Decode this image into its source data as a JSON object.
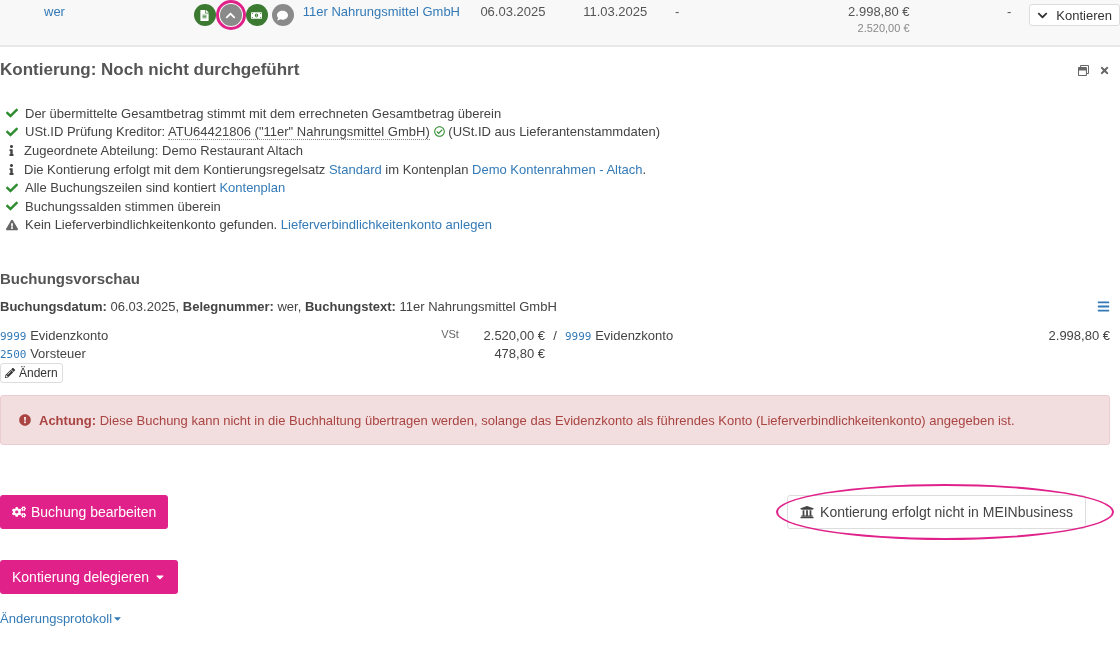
{
  "document_row": {
    "reference": "wer",
    "icons": [
      {
        "kind": "document",
        "color": "#3c7a32",
        "highlighted": false
      },
      {
        "kind": "collapse",
        "color": "#8a8a8a",
        "highlighted": true
      },
      {
        "kind": "money",
        "color": "#3c7a32",
        "highlighted": false
      },
      {
        "kind": "comment",
        "color": "#8a8a8a",
        "highlighted": false
      }
    ],
    "vendor": "11er Nahrungsmittel GmbH",
    "date_1": "06.03.2025",
    "date_2": "11.03.2025",
    "column_6": "-",
    "gross_amount": "2.998,80 €",
    "net_amount": "2.520,00 €",
    "column_8": "-",
    "action_button": "Kontieren"
  },
  "panel": {
    "title": "Kontierung: Noch nicht durchgeführt",
    "checks": [
      {
        "kind": "check",
        "parts": [
          {
            "kind": "text",
            "text": "Der übermittelte Gesamtbetrag stimmt mit dem errechneten Gesamtbetrag überein"
          }
        ]
      },
      {
        "kind": "check",
        "parts": [
          {
            "kind": "text",
            "text": "USt.ID Prüfung Kreditor: "
          },
          {
            "kind": "dotted",
            "text": "ATU64421806 (\"11er\" Nahrungsmittel GmbH)"
          },
          {
            "kind": "ok-icon"
          },
          {
            "kind": "text",
            "text": " (USt.ID aus Lieferantenstammdaten)"
          }
        ]
      },
      {
        "kind": "info",
        "parts": [
          {
            "kind": "text",
            "text": "Zugeordnete Abteilung: Demo Restaurant Altach"
          }
        ]
      },
      {
        "kind": "info",
        "parts": [
          {
            "kind": "text",
            "text": "Die Kontierung erfolgt mit dem Kontierungsregelsatz "
          },
          {
            "kind": "link",
            "text": "Standard"
          },
          {
            "kind": "text",
            "text": " im Kontenplan "
          },
          {
            "kind": "link",
            "text": "Demo Kontenrahmen - Altach"
          },
          {
            "kind": "text",
            "text": "."
          }
        ]
      },
      {
        "kind": "check",
        "parts": [
          {
            "kind": "text",
            "text": "Alle Buchungszeilen sind kontiert "
          },
          {
            "kind": "link",
            "text": "Kontenplan"
          }
        ]
      },
      {
        "kind": "check",
        "parts": [
          {
            "kind": "text",
            "text": "Buchungssalden stimmen überein"
          }
        ]
      },
      {
        "kind": "warning",
        "parts": [
          {
            "kind": "text",
            "text": "Kein Lieferverbindlichkeitenkonto gefunden. "
          },
          {
            "kind": "link",
            "text": "Lieferverbindlichkeitenkonto anlegen"
          }
        ]
      }
    ],
    "preview": {
      "title": "Buchungsvorschau",
      "header": "**Buchungsdatum:** 06.03.2025, **Belegnummer:** wer, **Buchungstext:** 11er Nahrungsmittel GmbH",
      "lines": [
        {
          "debit_account": "9999",
          "debit_name": "Evidenzkonto",
          "tax_code": "VSt",
          "debit_amount": "2.520,00 €",
          "separator": "/",
          "credit_account": "9999",
          "credit_name": "Evidenzkonto",
          "credit_amount": "2.998,80 €"
        },
        {
          "debit_account": "2500",
          "debit_name": "Vorsteuer",
          "debit_amount": "478,80 €"
        }
      ],
      "edit_button": "Ändern"
    },
    "alert": "**Achtung:** Diese Buchung kann nicht in die Buchhaltung übertragen werden, solange das Evidenzkonto als führendes Konto (Lieferverbindlichkeitenkonto) angegeben ist.",
    "edit_booking_button": "Buchung bearbeiten",
    "external_button": {
      "label": "Kontierung erfolgt nicht in MEINbusiness",
      "highlighted": true
    },
    "delegate_button": "Kontierung delegieren",
    "history_link": "Änderungsprotokoll"
  }
}
